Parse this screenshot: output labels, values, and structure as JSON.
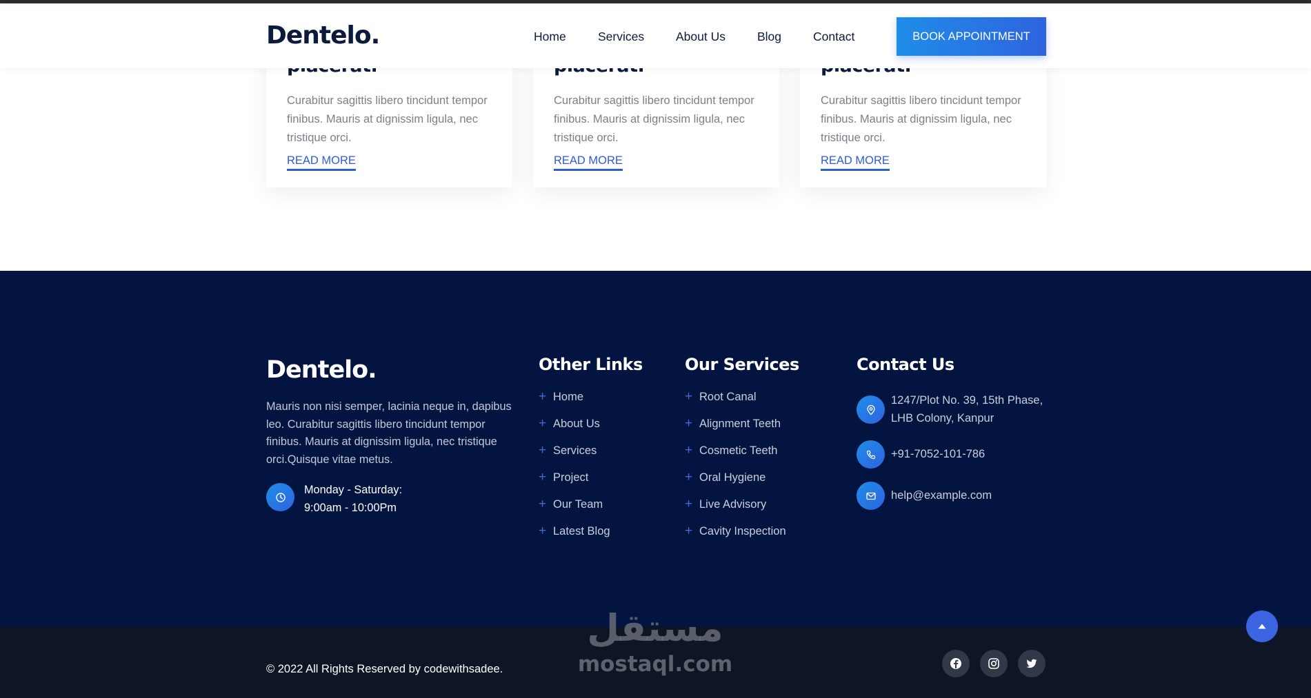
{
  "header": {
    "logo": "Dentelo.",
    "nav": [
      "Home",
      "Services",
      "About Us",
      "Blog",
      "Contact"
    ],
    "cta": "BOOK APPOINTMENT"
  },
  "cards": [
    {
      "title": "placerat.",
      "text": "Curabitur sagittis libero tincidunt tempor finibus. Mauris at dignissim ligula, nec tristique orci.",
      "link": "READ MORE"
    },
    {
      "title": "placerat.",
      "text": "Curabitur sagittis libero tincidunt tempor finibus. Mauris at dignissim ligula, nec tristique orci.",
      "link": "READ MORE"
    },
    {
      "title": "placerat.",
      "text": "Curabitur sagittis libero tincidunt tempor finibus. Mauris at dignissim ligula, nec tristique orci.",
      "link": "READ MORE"
    }
  ],
  "footer": {
    "logo": "Dentelo.",
    "description": "Mauris non nisi semper, lacinia neque in, dapibus leo. Curabitur sagittis libero tincidunt tempor finibus. Mauris at dignissim ligula, nec tristique orci.Quisque vitae metus.",
    "hours_days": "Monday - Saturday:",
    "hours_time": "9:00am - 10:00Pm",
    "other_links": {
      "heading": "Other Links",
      "items": [
        "Home",
        "About Us",
        "Services",
        "Project",
        "Our Team",
        "Latest Blog"
      ]
    },
    "our_services": {
      "heading": "Our Services",
      "items": [
        "Root Canal",
        "Alignment Teeth",
        "Cosmetic Teeth",
        "Oral Hygiene",
        "Live Advisory",
        "Cavity Inspection"
      ]
    },
    "contact": {
      "heading": "Contact Us",
      "address_line1": "1247/Plot No. 39, 15th Phase,",
      "address_line2": "LHB Colony, Kanpur",
      "phone": "+91-7052-101-786",
      "email": "help@example.com"
    }
  },
  "bottom": {
    "copyright": "© 2022 All Rights Reserved by codewithsadee.",
    "social": [
      "facebook-icon",
      "instagram-icon",
      "twitter-icon"
    ]
  },
  "watermark": {
    "arabic": "مستقل",
    "latin": "mostaql.com"
  },
  "colors": {
    "brand_dark": "#0c1a3c",
    "footer_bg": "#02143f",
    "accent": "#2f63e0"
  }
}
